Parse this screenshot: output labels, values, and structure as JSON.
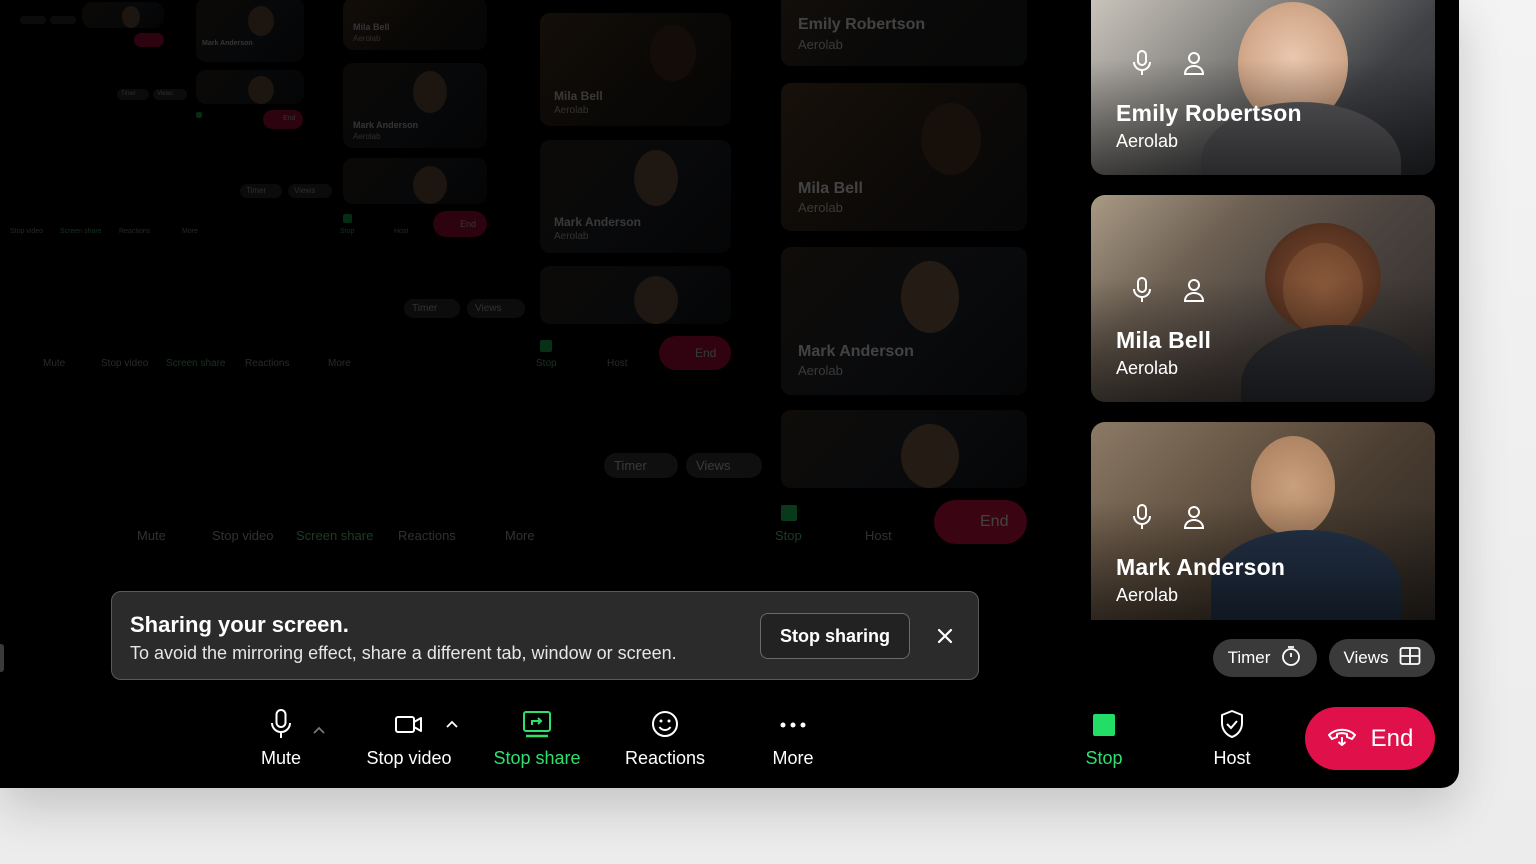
{
  "participants": [
    {
      "name": "Emily Robertson",
      "org": "Aerolab"
    },
    {
      "name": "Mila Bell",
      "org": "Aerolab"
    },
    {
      "name": "Mark Anderson",
      "org": "Aerolab"
    }
  ],
  "pills": {
    "timer": "Timer",
    "views": "Views"
  },
  "banner": {
    "title": "Sharing your screen.",
    "description": "To avoid the mirroring effect, share a different tab, window or screen.",
    "stop_button": "Stop sharing"
  },
  "toolbar": {
    "mute": "Mute",
    "stop_video": "Stop video",
    "stop_share": "Stop share",
    "reactions": "Reactions",
    "more": "More",
    "stop": "Stop",
    "host": "Host",
    "end": "End"
  },
  "ghost_labels": {
    "mute": "Mute",
    "stop_video": "Stop video",
    "screen_share": "Screen share",
    "reactions": "Reactions",
    "more": "More",
    "stop": "Stop",
    "host": "Host",
    "end": "End",
    "timer": "Timer",
    "views": "Views",
    "p1": "Emily Robertson",
    "p2": "Mila Bell",
    "p3": "Mark Anderson",
    "org": "Aerolab"
  },
  "colors": {
    "accent_green": "#2ee06b",
    "end_red": "#e0104a",
    "pill_bg": "#3a3a3a",
    "banner_bg": "#2b2b2b"
  },
  "icons": [
    "mic-icon",
    "person-icon",
    "timer-icon",
    "grid-icon",
    "video-icon",
    "screen-share-icon",
    "smiley-icon",
    "more-dots-icon",
    "stop-square-icon",
    "shield-icon",
    "phone-end-icon",
    "close-icon",
    "caret-up-icon"
  ]
}
